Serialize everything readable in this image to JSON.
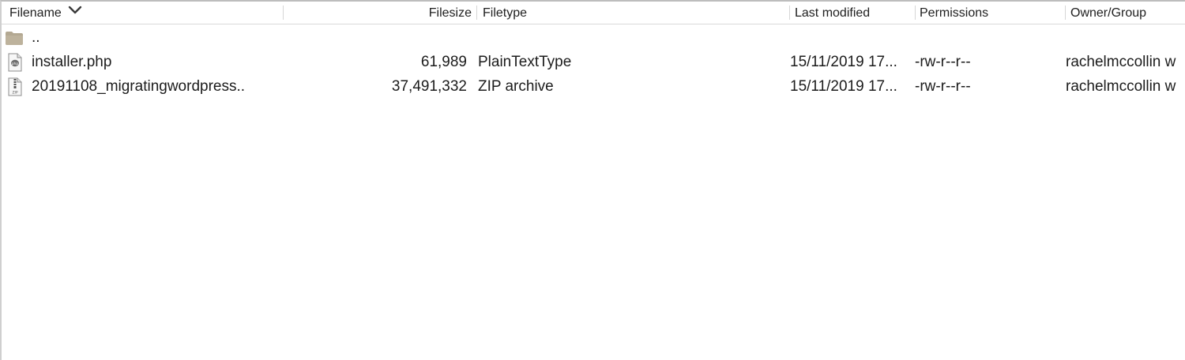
{
  "header": {
    "filename": "Filename",
    "filesize": "Filesize",
    "filetype": "Filetype",
    "last_modified": "Last modified",
    "permissions": "Permissions",
    "owner_group": "Owner/Group"
  },
  "rows": [
    {
      "icon": "folder-icon",
      "filename": "..",
      "filesize": "",
      "filetype": "",
      "last_modified": "",
      "permissions": "",
      "owner_group": ""
    },
    {
      "icon": "php-file-icon",
      "filename": "installer.php",
      "filesize": "61,989",
      "filetype": "PlainTextType",
      "last_modified": "15/11/2019 17...",
      "permissions": "-rw-r--r--",
      "owner_group": "rachelmccollin w"
    },
    {
      "icon": "zip-file-icon",
      "filename": "20191108_migratingwordpress..",
      "filesize": "37,491,332",
      "filetype": "ZIP archive",
      "last_modified": "15/11/2019 17...",
      "permissions": "-rw-r--r--",
      "owner_group": "rachelmccollin w"
    }
  ],
  "colors": {
    "folder": "#b3a892",
    "header_separator": "#d6d6d6",
    "text": "#1c1c1c"
  }
}
